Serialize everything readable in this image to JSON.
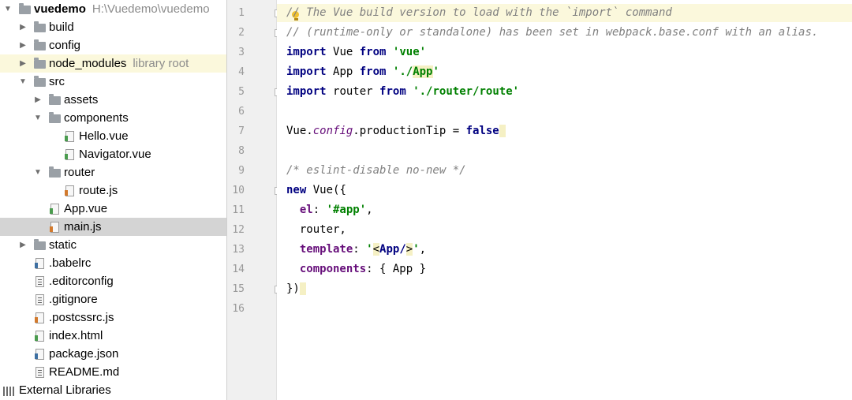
{
  "project_tree": {
    "rows": [
      {
        "label": "vuedemo",
        "extra": "H:\\Vuedemo\\vuedemo",
        "expanded": true,
        "icon": "folder-icon",
        "bold": true
      },
      {
        "label": "build",
        "expanded": false,
        "icon": "folder-icon"
      },
      {
        "label": "config",
        "expanded": false,
        "icon": "folder-icon"
      },
      {
        "label": "node_modules",
        "extra": "library root",
        "expanded": false,
        "icon": "folder-icon"
      },
      {
        "label": "src",
        "expanded": true,
        "icon": "folder-icon"
      },
      {
        "label": "assets",
        "expanded": false,
        "icon": "folder-icon"
      },
      {
        "label": "components",
        "expanded": true,
        "icon": "folder-icon"
      },
      {
        "label": "Hello.vue",
        "icon": "vue-file-icon"
      },
      {
        "label": "Navigator.vue",
        "icon": "vue-file-icon"
      },
      {
        "label": "router",
        "expanded": true,
        "icon": "folder-icon"
      },
      {
        "label": "route.js",
        "icon": "js-file-icon"
      },
      {
        "label": "App.vue",
        "icon": "vue-file-icon"
      },
      {
        "label": "main.js",
        "icon": "js-file-icon",
        "selected": true
      },
      {
        "label": "static",
        "expanded": false,
        "icon": "folder-icon"
      },
      {
        "label": ".babelrc",
        "icon": "json-file-icon"
      },
      {
        "label": ".editorconfig",
        "icon": "text-file-icon"
      },
      {
        "label": ".gitignore",
        "icon": "text-file-icon"
      },
      {
        "label": ".postcssrc.js",
        "icon": "js-file-icon"
      },
      {
        "label": "index.html",
        "icon": "html-file-icon"
      },
      {
        "label": "package.json",
        "icon": "json-file-icon"
      },
      {
        "label": "README.md",
        "icon": "text-file-icon"
      },
      {
        "label": "External Libraries",
        "icon": "external-libraries-icon"
      }
    ]
  },
  "editor": {
    "line_numbers": [
      "1",
      "2",
      "3",
      "4",
      "5",
      "6",
      "7",
      "8",
      "9",
      "10",
      "11",
      "12",
      "13",
      "14",
      "15",
      "16"
    ],
    "code": {
      "l1": "// The Vue build version to load with the `import` command",
      "l2": "// (runtime-only or standalone) has been set in webpack.base.conf with an alias.",
      "import": "import",
      "from": "from",
      "vue_name": "Vue",
      "vue_str": "'vue'",
      "app_name": "App",
      "app_str_a": "'./",
      "app_str_b": "App",
      "app_str_c": "'",
      "router_name": "router",
      "router_str": "'./router/route'",
      "l7_a": "Vue.",
      "l7_b": "config",
      "l7_c": ".productionTip = ",
      "l7_d": "false",
      "l9": "/* eslint-disable no-new */",
      "new_kw": "new",
      "new_rest": " Vue({",
      "el_key": "el",
      "el_val": "'#app'",
      "router_line": "router,",
      "tmpl_key": "template",
      "tmpl_q1": "'",
      "tmpl_lt": "<",
      "tmpl_tag": "App/",
      "tmpl_gt": ">",
      "tmpl_q2": "'",
      "comp_key": "components",
      "comp_val": ": { App }",
      "close": "})"
    }
  }
}
